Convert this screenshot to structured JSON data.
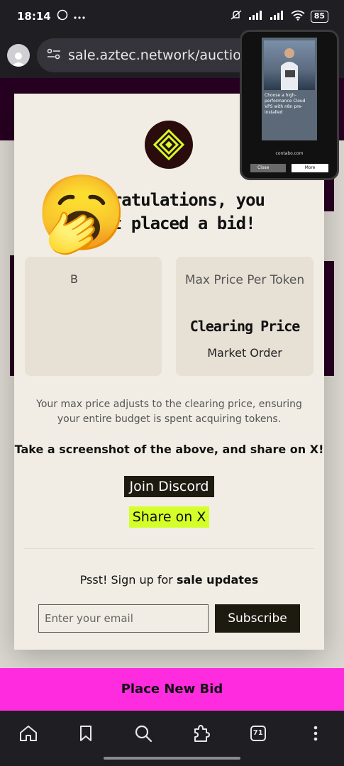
{
  "status_bar": {
    "time": "18:14",
    "battery": "85"
  },
  "browser": {
    "url": "sale.aztec.network/auction"
  },
  "modal": {
    "title_line1": "Congratulations, you",
    "title_line2": "just placed a bid!",
    "left_card": {
      "label_partial": "B"
    },
    "right_card": {
      "label": "Max Price Per Token",
      "value": "Clearing Price",
      "sub": "Market Order"
    },
    "info_text": "Your max price adjusts to the clearing price, ensuring your entire budget is spent acquiring tokens.",
    "cta_text": "Take a screenshot of the above, and share on X!",
    "discord_label": "Join Discord",
    "share_label": "Share on X",
    "signup_prefix": "Psst! Sign up for ",
    "signup_bold": "sale updates",
    "email_placeholder": "Enter your email",
    "subscribe_label": "Subscribe"
  },
  "overlay_emoji": "🥱",
  "pip_ad": {
    "headline": "Choose a high-performance Cloud VPS with n8n pre-installed",
    "domain": "contabo.com",
    "close_label": "Close",
    "more_label": "More"
  },
  "place_bid_label": "Place New Bid",
  "bottom_nav": {
    "tab_count": "71"
  },
  "colors": {
    "brand_magenta": "#ff2bdf",
    "accent_lime": "#d4ff28",
    "dark_plum": "#2b0024",
    "modal_bg": "#f1ede4"
  }
}
